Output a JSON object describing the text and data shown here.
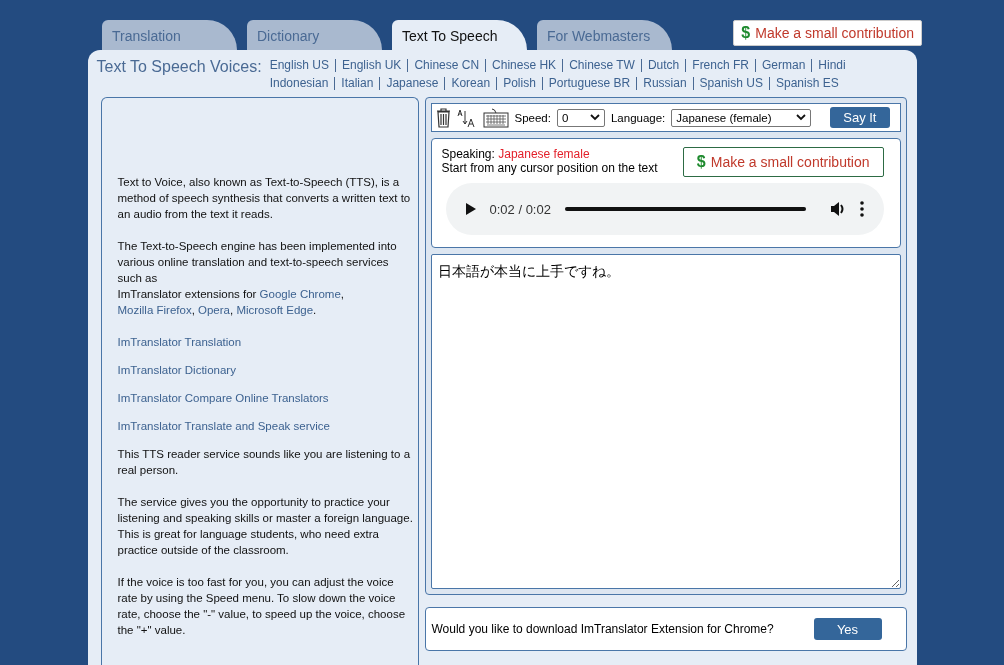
{
  "tabs": [
    {
      "label": "Translation",
      "selected": false
    },
    {
      "label": "Dictionary",
      "selected": false
    },
    {
      "label": "Text To Speech",
      "selected": true
    },
    {
      "label": "For Webmasters",
      "selected": false
    }
  ],
  "contribution_top": {
    "symbol": "$",
    "label": "Make a small contribution"
  },
  "voices": {
    "label": "Text To Speech Voices:",
    "links": [
      "English US",
      "English UK",
      "Chinese CN",
      "Chinese HK",
      "Chinese TW",
      "Dutch",
      "French FR",
      "German",
      "Hindi",
      "Indonesian",
      "Italian",
      "Japanese",
      "Korean",
      "Polish",
      "Portuguese BR",
      "Russian",
      "Spanish US",
      "Spanish ES"
    ]
  },
  "info": {
    "paragraphs": [
      {
        "kind": "text",
        "segments": [
          {
            "kind": "text",
            "text": "Text to Voice, also known as Text-to-Speech (TTS), is a method of speech synthesis that converts a written text to an audio from the text it reads."
          }
        ]
      },
      {
        "kind": "text",
        "segments": [
          {
            "kind": "text",
            "text": "The Text-to-Speech engine has been implemented into various online translation and text-to-speech services such as"
          },
          {
            "kind": "break"
          },
          {
            "kind": "text",
            "text": "ImTranslator extensions for "
          },
          {
            "kind": "link",
            "text": "Google Chrome"
          },
          {
            "kind": "text",
            "text": ", "
          },
          {
            "kind": "link",
            "text": "Mozilla Firefox"
          },
          {
            "kind": "text",
            "text": ", "
          },
          {
            "kind": "link",
            "text": "Opera"
          },
          {
            "kind": "text",
            "text": ", "
          },
          {
            "kind": "link",
            "text": "Microsoft Edge"
          },
          {
            "kind": "text",
            "text": "."
          }
        ]
      },
      {
        "kind": "link",
        "segments": [
          {
            "kind": "link",
            "text": "ImTranslator Translation"
          }
        ]
      },
      {
        "kind": "link",
        "segments": [
          {
            "kind": "link",
            "text": "ImTranslator Dictionary"
          }
        ]
      },
      {
        "kind": "link",
        "segments": [
          {
            "kind": "link",
            "text": "ImTranslator Compare Online Translators"
          }
        ]
      },
      {
        "kind": "link",
        "segments": [
          {
            "kind": "link",
            "text": "ImTranslator Translate and Speak service"
          }
        ]
      },
      {
        "kind": "text",
        "segments": [
          {
            "kind": "text",
            "text": "This TTS reader service sounds like you are listening to a real person."
          }
        ]
      },
      {
        "kind": "text",
        "segments": [
          {
            "kind": "text",
            "text": "The service gives you the opportunity to practice your listening and speaking skills or master a foreign language. This is great for language students, who need extra practice outside of the classroom."
          }
        ]
      },
      {
        "kind": "text",
        "segments": [
          {
            "kind": "text",
            "text": "If the voice is too fast for you, you can adjust the voice rate by using the Speed menu. To slow down the voice rate, choose the \"-\" value, to speed up the voice, choose the \"+\" value."
          }
        ]
      }
    ]
  },
  "toolbar": {
    "speed_label": "Speed:",
    "speed_value": "0",
    "language_label": "Language:",
    "language_value": "Japanese (female)",
    "say_button": "Say It"
  },
  "speaking": {
    "label": "Speaking:",
    "voice": "Japanese female",
    "hint": "Start from any cursor position on the text",
    "contribution": {
      "symbol": "$",
      "label": "Make a small contribution"
    }
  },
  "player": {
    "time": "0:02 / 0:02",
    "level": 1
  },
  "text_input": {
    "value": "日本語が本当に上手ですね。"
  },
  "extension_prompt": {
    "question": "Would you like to download ImTranslator Extension for Chrome?",
    "button": "Yes"
  }
}
